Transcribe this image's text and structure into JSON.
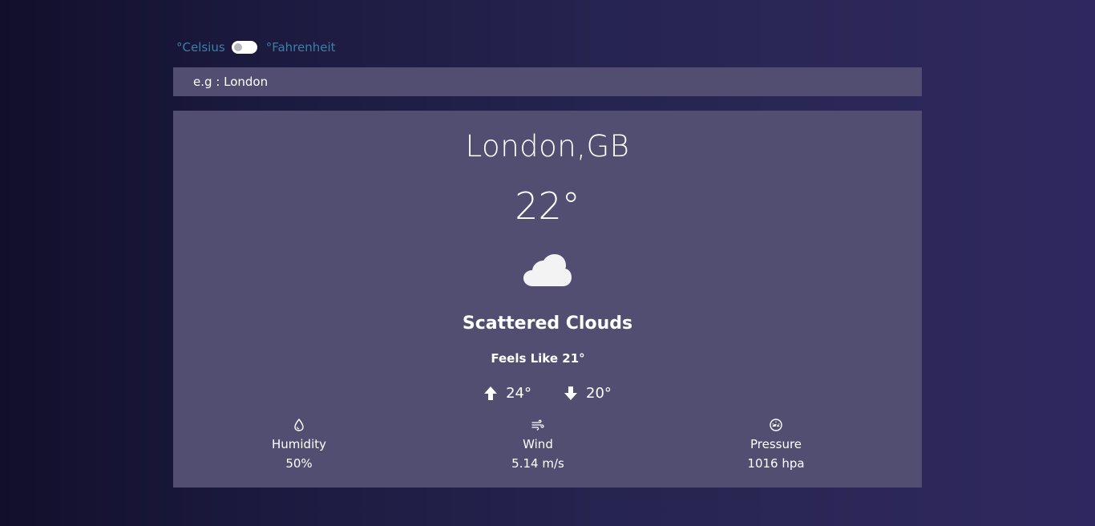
{
  "units": {
    "celsius_label": "°Celsius",
    "fahrenheit_label": "°Fahrenheit",
    "selected": "Celsius"
  },
  "search": {
    "placeholder": "e.g : London",
    "value": ""
  },
  "weather": {
    "city": "London,GB",
    "temperature": "22°",
    "condition_icon": "cloud-icon",
    "description": "Scattered Clouds",
    "feels_like": "Feels Like 21°",
    "temp_max": "24°",
    "temp_min": "20°",
    "humidity_label": "Humidity",
    "humidity_value": "50%",
    "wind_label": "Wind",
    "wind_value": "5.14 m/s",
    "pressure_label": "Pressure",
    "pressure_value": "1016 hpa"
  },
  "colors": {
    "card_bg": "#524e71",
    "toggle_label": "#3d7fa6",
    "background_left": "#120f2c",
    "background_right": "#2f2860"
  }
}
